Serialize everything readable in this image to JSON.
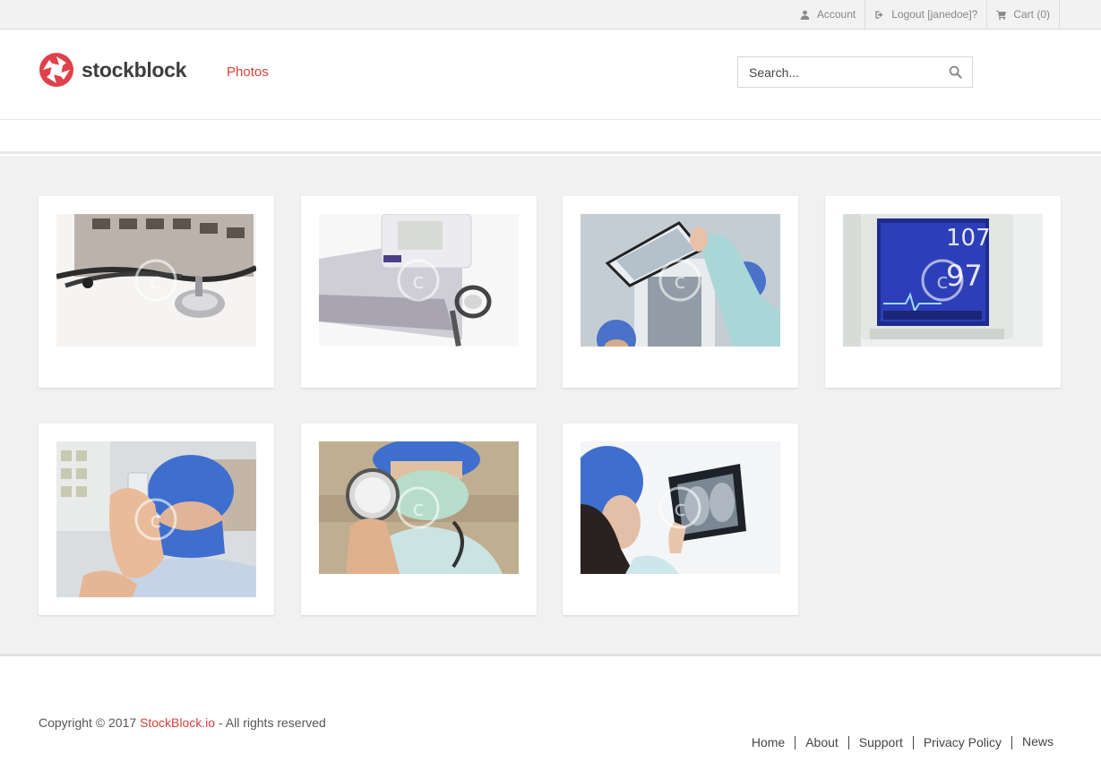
{
  "topbar": {
    "account": "Account",
    "logout": "Logout [janedoe]?",
    "cart": "Cart (0)"
  },
  "header": {
    "logo_text": "stockblock",
    "nav_photos": "Photos",
    "search_placeholder": "Search..."
  },
  "photos": [
    {
      "subject": "stethoscope and calculator"
    },
    {
      "subject": "blood pressure monitor and stethoscope"
    },
    {
      "subject": "doctors examining x-ray"
    },
    {
      "subject": "heart rate monitor"
    },
    {
      "subject": "nurse holding vial"
    },
    {
      "subject": "doctor holding stethoscope"
    },
    {
      "subject": "nurse viewing chest x-ray"
    }
  ],
  "footer": {
    "copyright_prefix": "Copyright © 2017 ",
    "brand": "StockBlock.io",
    "copyright_suffix": " - All rights reserved",
    "links": [
      "Home",
      "About",
      "Support",
      "Privacy Policy",
      "News"
    ]
  },
  "colors": {
    "accent": "#d9403a",
    "background": "#f1f1f1"
  }
}
